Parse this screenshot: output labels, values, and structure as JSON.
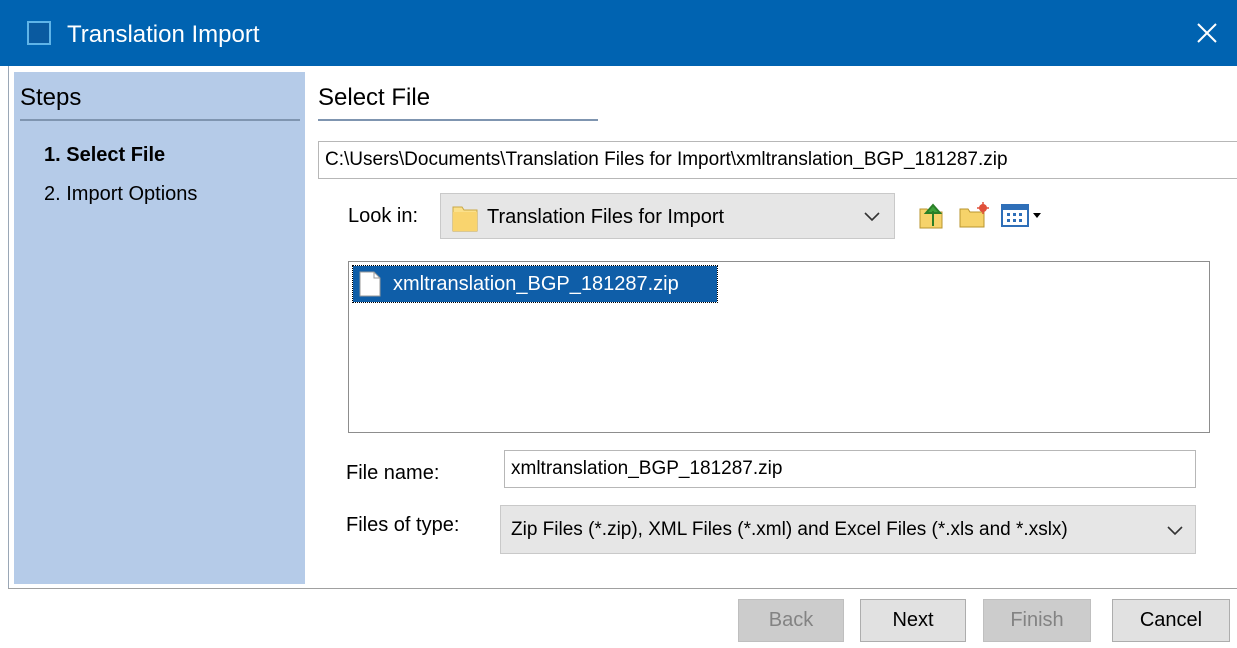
{
  "window": {
    "title": "Translation Import"
  },
  "steps": {
    "title": "Steps",
    "items": [
      {
        "label": "1. Select File",
        "active": true
      },
      {
        "label": "2. Import Options",
        "active": false
      }
    ]
  },
  "main": {
    "section_title": "Select File",
    "path": "C:\\Users\\Documents\\Translation Files for Import\\xmltranslation_BGP_181287.zip",
    "look_in": {
      "label": "Look in:",
      "value": "Translation Files for Import"
    },
    "toolbar_icons": [
      "up-one-level-icon",
      "create-new-folder-icon",
      "view-menu-icon"
    ],
    "files": [
      {
        "name": "xmltranslation_BGP_181287.zip",
        "selected": true
      }
    ],
    "file_name": {
      "label": "File name:",
      "value": "xmltranslation_BGP_181287.zip"
    },
    "file_type": {
      "label": "Files of type:",
      "value": "Zip Files (*.zip), XML Files (*.xml) and Excel Files (*.xls and *.xslx)"
    }
  },
  "buttons": {
    "back": "Back",
    "next": "Next",
    "finish": "Finish",
    "cancel": "Cancel"
  },
  "colors": {
    "titlebar": "#0063b1",
    "steps_panel": "#b5cbe8",
    "selection": "#0f5ea8"
  }
}
